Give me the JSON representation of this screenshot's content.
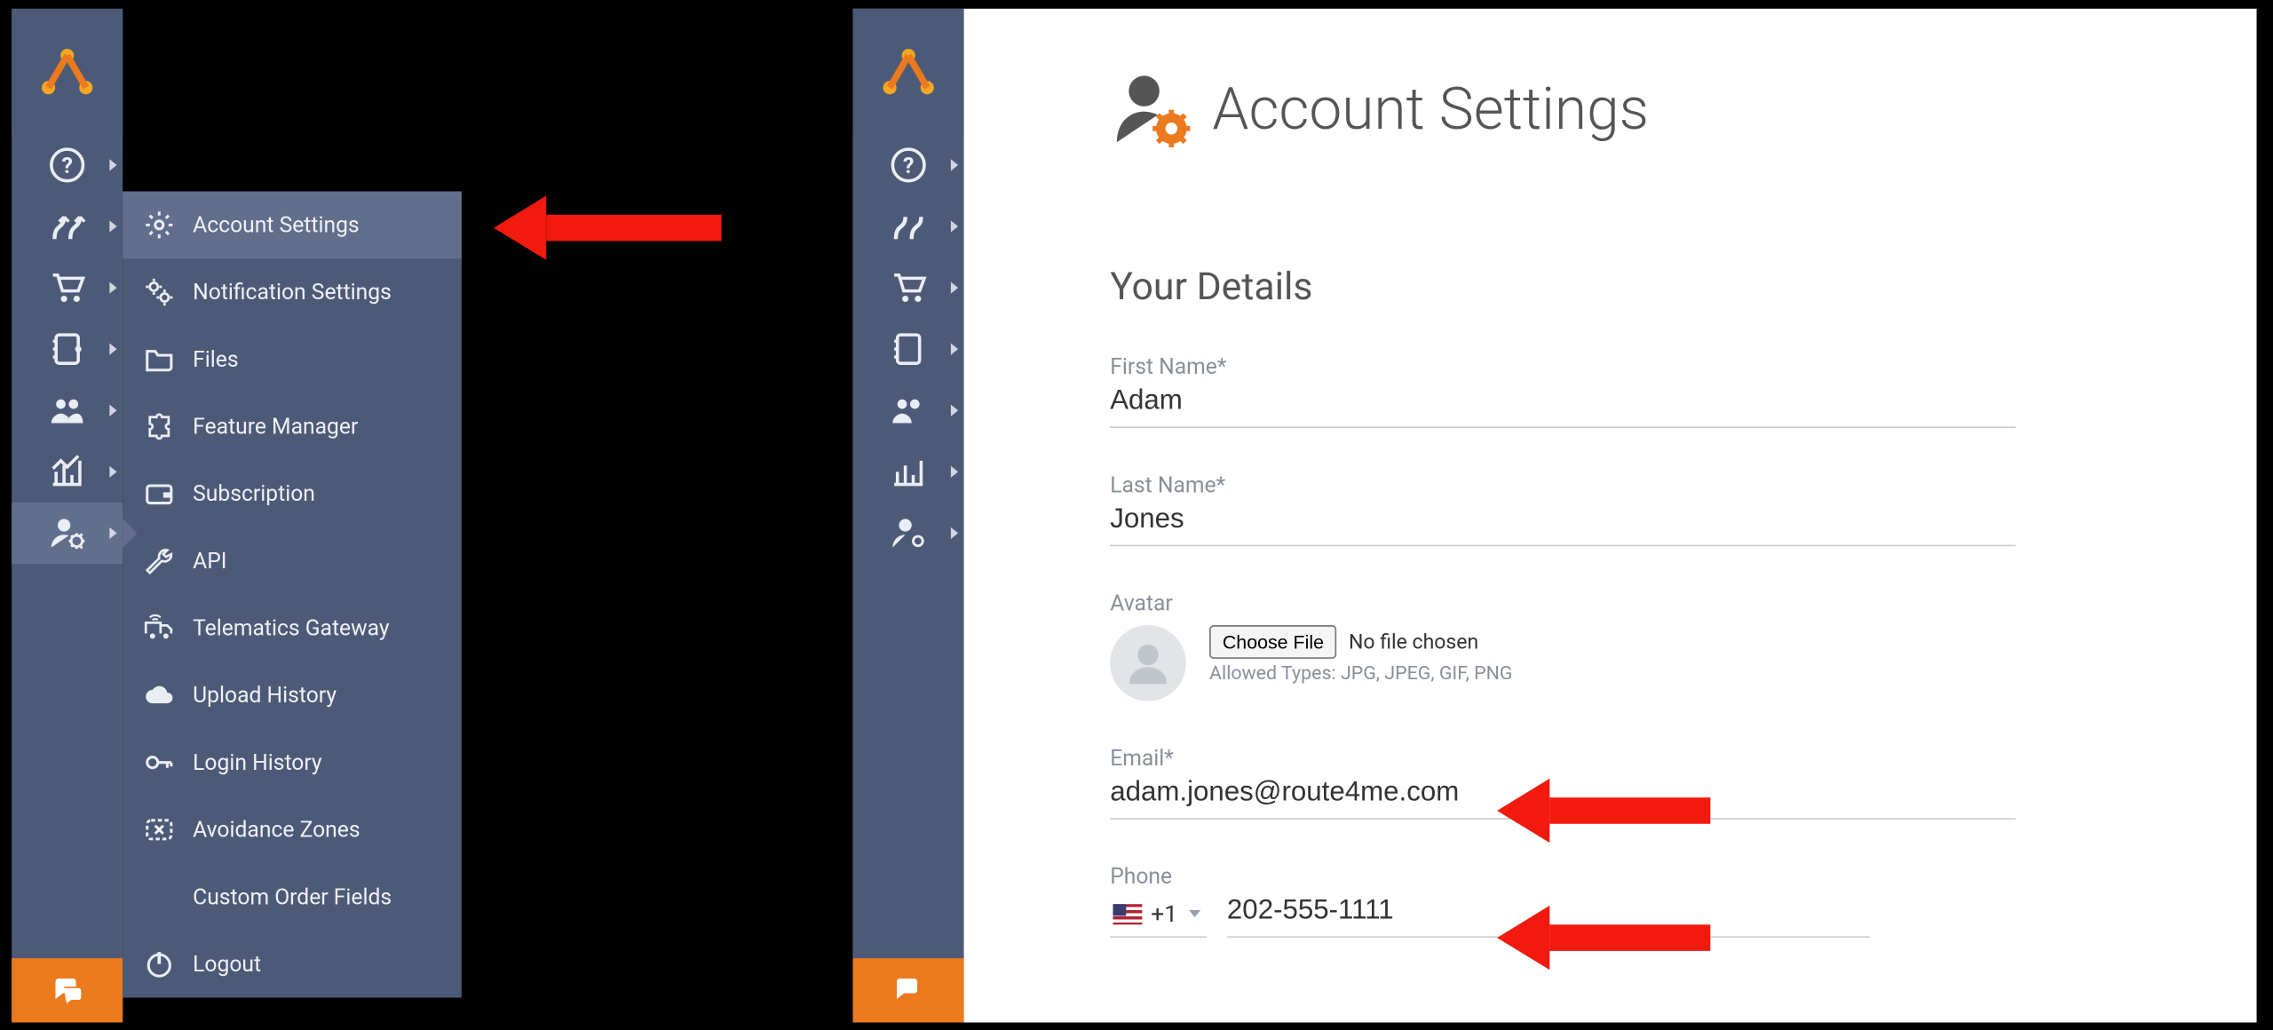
{
  "flyout": {
    "items": [
      {
        "label": "Account Settings",
        "icon": "gear-icon"
      },
      {
        "label": "Notification Settings",
        "icon": "gears-icon"
      },
      {
        "label": "Files",
        "icon": "folder-icon"
      },
      {
        "label": "Feature Manager",
        "icon": "puzzle-icon"
      },
      {
        "label": "Subscription",
        "icon": "wallet-icon"
      },
      {
        "label": "API",
        "icon": "wrench-icon"
      },
      {
        "label": "Telematics Gateway",
        "icon": "truck-icon"
      },
      {
        "label": "Upload History",
        "icon": "cloud-upload-icon"
      },
      {
        "label": "Login History",
        "icon": "key-icon"
      },
      {
        "label": "Avoidance Zones",
        "icon": "zone-x-icon"
      },
      {
        "label": "Custom Order Fields",
        "icon": ""
      },
      {
        "label": "Logout",
        "icon": "power-icon"
      }
    ]
  },
  "page": {
    "title": "Account Settings",
    "section": "Your Details",
    "first_name_label": "First Name*",
    "first_name_value": "Adam",
    "last_name_label": "Last Name*",
    "last_name_value": "Jones",
    "avatar_label": "Avatar",
    "choose_file_label": "Choose File",
    "no_file_text": "No file chosen",
    "avatar_hint": "Allowed Types: JPG, JPEG, GIF, PNG",
    "email_label": "Email*",
    "email_value": "adam.jones@route4me.com",
    "phone_label": "Phone",
    "phone_cc": "+1",
    "phone_value": "202-555-1111"
  }
}
